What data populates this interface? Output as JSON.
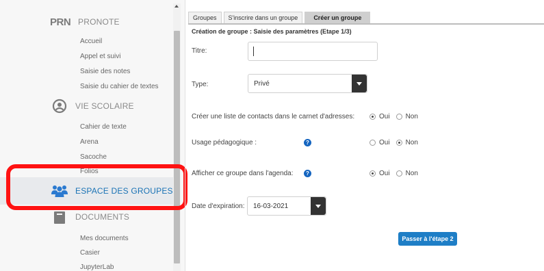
{
  "sidebar": {
    "pronote": {
      "logo": "PRN",
      "title": "PRONOTE",
      "items": [
        "Accueil",
        "Appel et suivi",
        "Saisie des notes",
        "Saisie du cahier de textes"
      ]
    },
    "vie_scolaire": {
      "title": "VIE SCOLAIRE",
      "items": [
        "Cahier de texte",
        "Arena",
        "Sacoche",
        "Folios"
      ]
    },
    "espace_groupes": {
      "title": "ESPACE DES GROUPES"
    },
    "documents": {
      "title": "DOCUMENTS",
      "items": [
        "Mes documents",
        "Casier",
        "JupyterLab"
      ]
    }
  },
  "tabs": [
    "Groupes",
    "S'inscrire dans un groupe",
    "Créer un groupe"
  ],
  "form": {
    "step_title": "Création de groupe : Saisie des paramètres (Etape 1/3)",
    "titre_label": "Titre:",
    "titre_value": "",
    "type_label": "Type:",
    "type_value": "Privé",
    "contacts_label": "Créer une liste de contacts dans le carnet d'adresses:",
    "usage_label": "Usage pédagogique :",
    "agenda_label": "Afficher ce groupe dans l'agenda:",
    "oui": "Oui",
    "non": "Non",
    "help_glyph": "?",
    "date_label": "Date d'expiration:",
    "date_value": "16-03-2021",
    "next_button": "Passer à l'étape 2"
  },
  "colors": {
    "accent_blue": "#1e7ec6",
    "highlight_red": "#ff1212",
    "help_blue": "#1565c0"
  }
}
